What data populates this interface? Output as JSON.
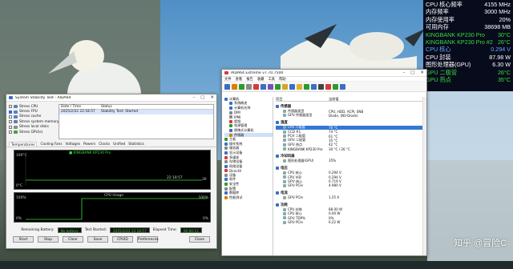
{
  "osd": [
    {
      "label": "CPU 核心频率",
      "value": "4155 MHz",
      "color": "#ffffff"
    },
    {
      "label": "内存频率",
      "value": "3000 MHz",
      "color": "#ffffff"
    },
    {
      "label": "内存使用率",
      "value": "20%",
      "color": "#ffffff"
    },
    {
      "label": "可用内存",
      "value": "38698 MB",
      "color": "#ffffff"
    },
    {
      "label": "KINGBANK KP230 Pro",
      "value": "30°C",
      "color": "#3ddc3d"
    },
    {
      "label": "KINGBANK KP230 Pro #2",
      "value": "26°C",
      "color": "#3ddc3d"
    },
    {
      "label": "CPU 核心",
      "value": "0.294 V",
      "color": "#6aa7ff"
    },
    {
      "label": "CPU 封装",
      "value": "87.98 W",
      "color": "#ffffff"
    },
    {
      "label": "图形处理器(GPU)",
      "value": "6.30 W",
      "color": "#ffffff"
    },
    {
      "label": "GPU 二极管",
      "value": "26°C",
      "color": "#3ddc3d"
    },
    {
      "label": "GPU 热点",
      "value": "35°C",
      "color": "#3ddc3d"
    }
  ],
  "stability": {
    "title": "System Stability Test - AIDA64",
    "stress": [
      {
        "label": "Stress CPU",
        "on": false,
        "color": "#5b7fb8"
      },
      {
        "label": "Stress FPU",
        "on": true,
        "color": "#5b7fb8"
      },
      {
        "label": "Stress cache",
        "on": false,
        "color": "#5b7fb8"
      },
      {
        "label": "Stress system memory",
        "on": false,
        "color": "#5b7fb8"
      },
      {
        "label": "Stress local disks",
        "on": false,
        "color": "#8a8a8a"
      },
      {
        "label": "Stress GPU(s)",
        "on": false,
        "color": "#4aa03a"
      }
    ],
    "log_headers": [
      "Date / Time",
      "Status"
    ],
    "log_rows": [
      {
        "date": "2025/2/22 22:18:57",
        "status": "Stability Test: Started"
      }
    ],
    "tabs": [
      "Temperatures",
      "Cooling Fans",
      "Voltages",
      "Powers",
      "Clocks",
      "Unified",
      "Statistics"
    ],
    "graph1": {
      "legend": "KINGBANK KP230 Pro",
      "top": "100°C",
      "bottom": "0°C",
      "time": "22:18:57",
      "val": "30"
    },
    "graph2": {
      "title": "CPU Usage",
      "top_l": "100%",
      "top_r": "100%",
      "bottom_l": "0%",
      "bottom_r": "0%"
    },
    "battery_label": "Remaining Battery:",
    "battery": "No battery",
    "started_label": "Test Started:",
    "started": "2025/2/22 22:18:57",
    "elapsed_label": "Elapsed Time:",
    "elapsed": "00:00:13",
    "buttons": [
      "Start",
      "Stop",
      "Clear",
      "Save",
      "CPUID",
      "Preferences",
      "Close"
    ]
  },
  "aida": {
    "title": "AIDA64 Extreme v7.70.7500",
    "menu": [
      "文件",
      "查看",
      "报告",
      "收藏",
      "工具",
      "帮助"
    ],
    "toolbar_colors": [
      "#3a6fc4",
      "#e07b00",
      "#2d9a2d",
      "#8a8a8a",
      "#d43a3a",
      "#3a6fc4",
      "#7a4fb8",
      "#2d9a2d",
      "#d4a52a",
      "#3a6fc4",
      "#e0b030",
      "#2d9a2d",
      "#3a6fc4",
      "#444",
      "#d43a3a",
      "#2d9a2d",
      "#3a6fc4"
    ],
    "tree": [
      {
        "label": "计算机",
        "color": "#3a6fc4"
      },
      {
        "label": "系统概述",
        "color": "#3a6fc4"
      },
      {
        "label": "计算机名称",
        "color": "#3a6fc4"
      },
      {
        "label": "DMI",
        "color": "#888"
      },
      {
        "label": "IPMI",
        "color": "#888"
      },
      {
        "label": "超频",
        "color": "#d43a3a"
      },
      {
        "label": "电源管理",
        "color": "#2d9a2d"
      },
      {
        "label": "便携式计算机",
        "color": "#3a6fc4"
      },
      {
        "label": "传感器",
        "color": "#e07b00"
      },
      {
        "label": "主板",
        "color": "#2d9a2d"
      },
      {
        "label": "操作系统",
        "color": "#3a6fc4"
      },
      {
        "label": "服务器",
        "color": "#888"
      },
      {
        "label": "显示设备",
        "color": "#3a6fc4"
      },
      {
        "label": "多媒体",
        "color": "#d43a3a"
      },
      {
        "label": "存储设备",
        "color": "#888"
      },
      {
        "label": "网络设备",
        "color": "#3a6fc4"
      },
      {
        "label": "DirectX",
        "color": "#d43a3a"
      },
      {
        "label": "设备",
        "color": "#888"
      },
      {
        "label": "软件",
        "color": "#3a6fc4"
      },
      {
        "label": "安全性",
        "color": "#2d9a2d"
      },
      {
        "label": "配置",
        "color": "#888"
      },
      {
        "label": "数据库",
        "color": "#3a6fc4"
      },
      {
        "label": "性能测试",
        "color": "#e07b00"
      }
    ],
    "col_headers": [
      "项目",
      "当前值"
    ],
    "sections": [
      {
        "name": "传感器",
        "rows": [
          [
            "传感器类型",
            "CPU, HDD, ACPI, SNB"
          ],
          [
            "GPU 传感器类型",
            "Diode, (NV-Diode)"
          ]
        ]
      },
      {
        "name": "温度",
        "rows": [
          [
            "CPU 二极管",
            "76 °C"
          ],
          [
            "CCD #1",
            "74 °C"
          ],
          [
            "PCH 二极管",
            "61 °C"
          ],
          [
            "GPU 二极管",
            "35 °C"
          ],
          [
            "GPU 热点",
            "42 °C"
          ],
          [
            "KINGBANK KP230 Pro",
            "30 °C / 26 °C"
          ]
        ]
      },
      {
        "name": "冷却风扇",
        "rows": [
          [
            "图形处理器(GPU)",
            "35%"
          ]
        ]
      },
      {
        "name": "电压",
        "rows": [
          [
            "CPU 核心",
            "0.294 V"
          ],
          [
            "CPU VID",
            "0.294 V"
          ],
          [
            "GPU 核心",
            "0.719 V"
          ],
          [
            "GPU PCIe",
            "4.980 V"
          ]
        ]
      },
      {
        "name": "电流",
        "rows": [
          [
            "GPU PCIe",
            "1.25 A"
          ]
        ]
      },
      {
        "name": "功耗",
        "rows": [
          [
            "CPU 封装",
            "88.00 W"
          ],
          [
            "CPU 核心",
            "0.00 W"
          ],
          [
            "GPU TDP%",
            "0%"
          ],
          [
            "GPU PCIe",
            "6.22 W"
          ]
        ]
      }
    ]
  },
  "watermark": "知乎 @冒险C"
}
